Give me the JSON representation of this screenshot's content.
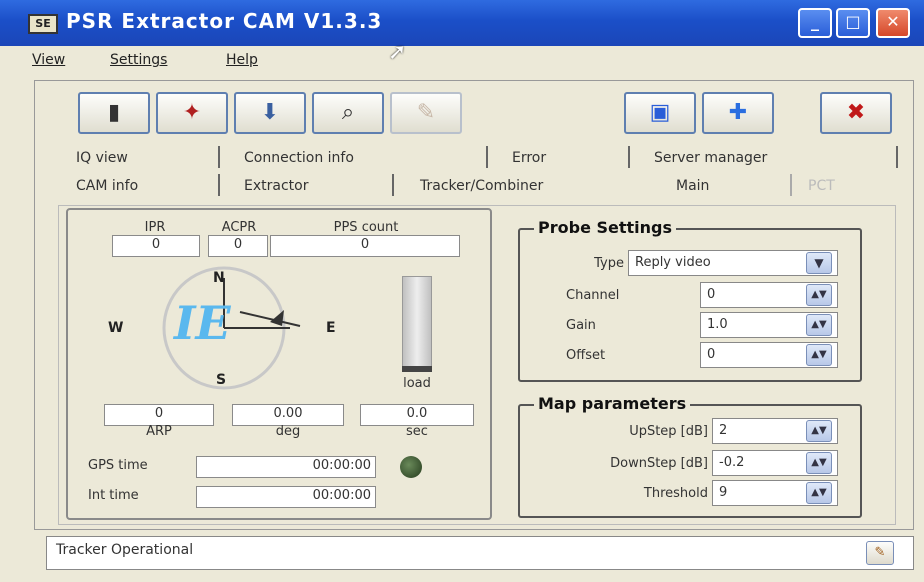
{
  "window": {
    "title": "PSR Extractor CAM  V1.3.3",
    "app_icon_label": "SE"
  },
  "menu": [
    {
      "label": "View"
    },
    {
      "label": "Settings"
    },
    {
      "label": "Help"
    }
  ],
  "toolbar": {
    "buttons": [
      {
        "name": "film-icon",
        "glyph": "▮"
      },
      {
        "name": "plugin-icon",
        "glyph": "✦"
      },
      {
        "name": "export-icon",
        "glyph": "⬇"
      },
      {
        "name": "search-icon",
        "glyph": "🔍"
      },
      {
        "name": "disabled-tool-icon",
        "glyph": "✎"
      },
      {
        "name": "monitor-icon",
        "glyph": "🖥"
      },
      {
        "name": "puzzle-icon",
        "glyph": "✚"
      },
      {
        "name": "close-icon",
        "glyph": "✖"
      }
    ]
  },
  "tabs": {
    "row1": [
      "IQ view",
      "Connection info",
      "Error",
      "Server manager"
    ],
    "row2": [
      "CAM info",
      "Extractor",
      "Tracker/Combiner",
      "Main",
      "PCT"
    ]
  },
  "counters": {
    "ipr_label": "IPR",
    "ipr": "0",
    "acpr_label": "ACPR",
    "acpr": "0",
    "pps_label": "PPS count",
    "pps": "0"
  },
  "compass": {
    "n": "N",
    "s": "S",
    "e": "E",
    "w": "W",
    "logo": "IE"
  },
  "load_label": "load",
  "readouts": {
    "arp": "0",
    "arp_label": "ARP",
    "deg": "0.00",
    "deg_label": "deg",
    "sec": "0.0",
    "sec_label": "sec"
  },
  "gps": {
    "gps_label": "GPS time",
    "gps_value": "00:00:00",
    "int_label": "Int time",
    "int_value": "00:00:00"
  },
  "probe": {
    "title": "Probe Settings",
    "type_label": "Type",
    "type_value": "Reply video",
    "channel_label": "Channel",
    "channel_value": "0",
    "gain_label": "Gain",
    "gain_value": "1.0",
    "offset_label": "Offset",
    "offset_value": "0"
  },
  "map": {
    "title": "Map parameters",
    "upstep_label": "UpStep [dB]",
    "upstep_value": "2",
    "downstep_label": "DownStep [dB]",
    "downstep_value": "-0.2",
    "threshold_label": "Threshold",
    "threshold_value": "9"
  },
  "status": {
    "text": "Tracker Operational"
  }
}
